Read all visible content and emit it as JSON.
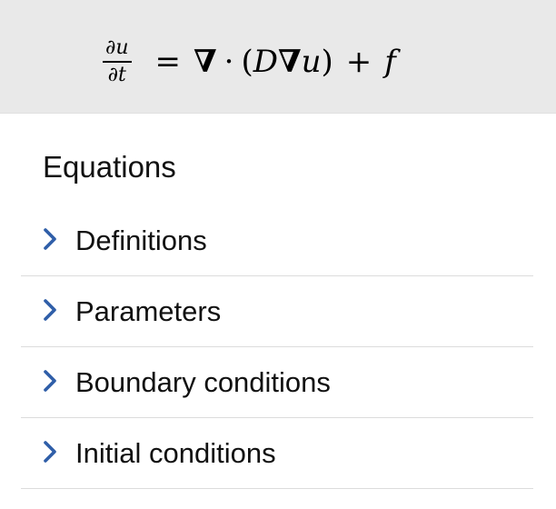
{
  "equation": {
    "numerator": "∂u",
    "denominator": "∂t",
    "equals": "=",
    "nabla1": "∇",
    "dot": "·",
    "open_paren": "(",
    "D": "D",
    "nabla2": "∇",
    "u": "u",
    "close_paren": ")",
    "plus": "+",
    "f": "f"
  },
  "section": {
    "title": "Equations"
  },
  "accordion": {
    "items": [
      {
        "label": "Definitions",
        "icon": "chevron-right-icon"
      },
      {
        "label": "Parameters",
        "icon": "chevron-right-icon"
      },
      {
        "label": "Boundary conditions",
        "icon": "chevron-right-icon"
      },
      {
        "label": "Initial conditions",
        "icon": "chevron-right-icon"
      }
    ]
  },
  "colors": {
    "header_bg": "#e9e9e9",
    "chevron": "#2f5ea8",
    "divider": "#dcdcdc",
    "text": "#111111"
  }
}
